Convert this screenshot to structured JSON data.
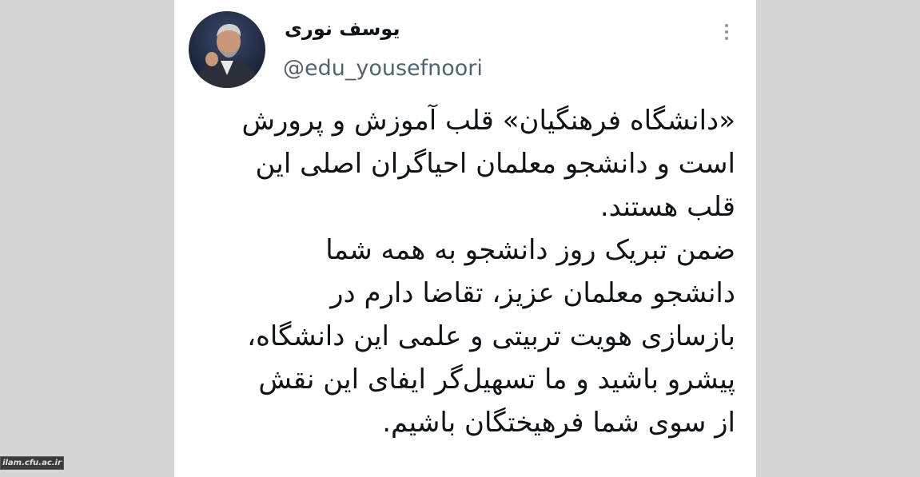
{
  "tweet": {
    "display_name": "یوسف نوری",
    "handle": "@edu_yousefnoori",
    "more_icon": "more-vertical-icon",
    "lines": [
      "«دانشگاه فرهنگیان» قلب آموزش و پرورش",
      "است و دانشجو معلمان احیاگران اصلی این",
      "قلب هستند.",
      "ضمن تبریک روز دانشجو به همه شما",
      "دانشجو معلمان عزیز، تقاضا دارم در",
      "بازسازی هویت تربیتی و علمی این دانشگاه،",
      "پیشرو باشید و ما تسهیل‌گر ایفای این نقش",
      "از سوی شما فرهیختگان باشیم."
    ]
  },
  "watermark": {
    "text": "ilam.cfu.ac.ir"
  },
  "colors": {
    "page_background": "#d6d6d6",
    "card_background": "#ffffff",
    "text": "#0f1419",
    "secondary_text": "#536471"
  }
}
